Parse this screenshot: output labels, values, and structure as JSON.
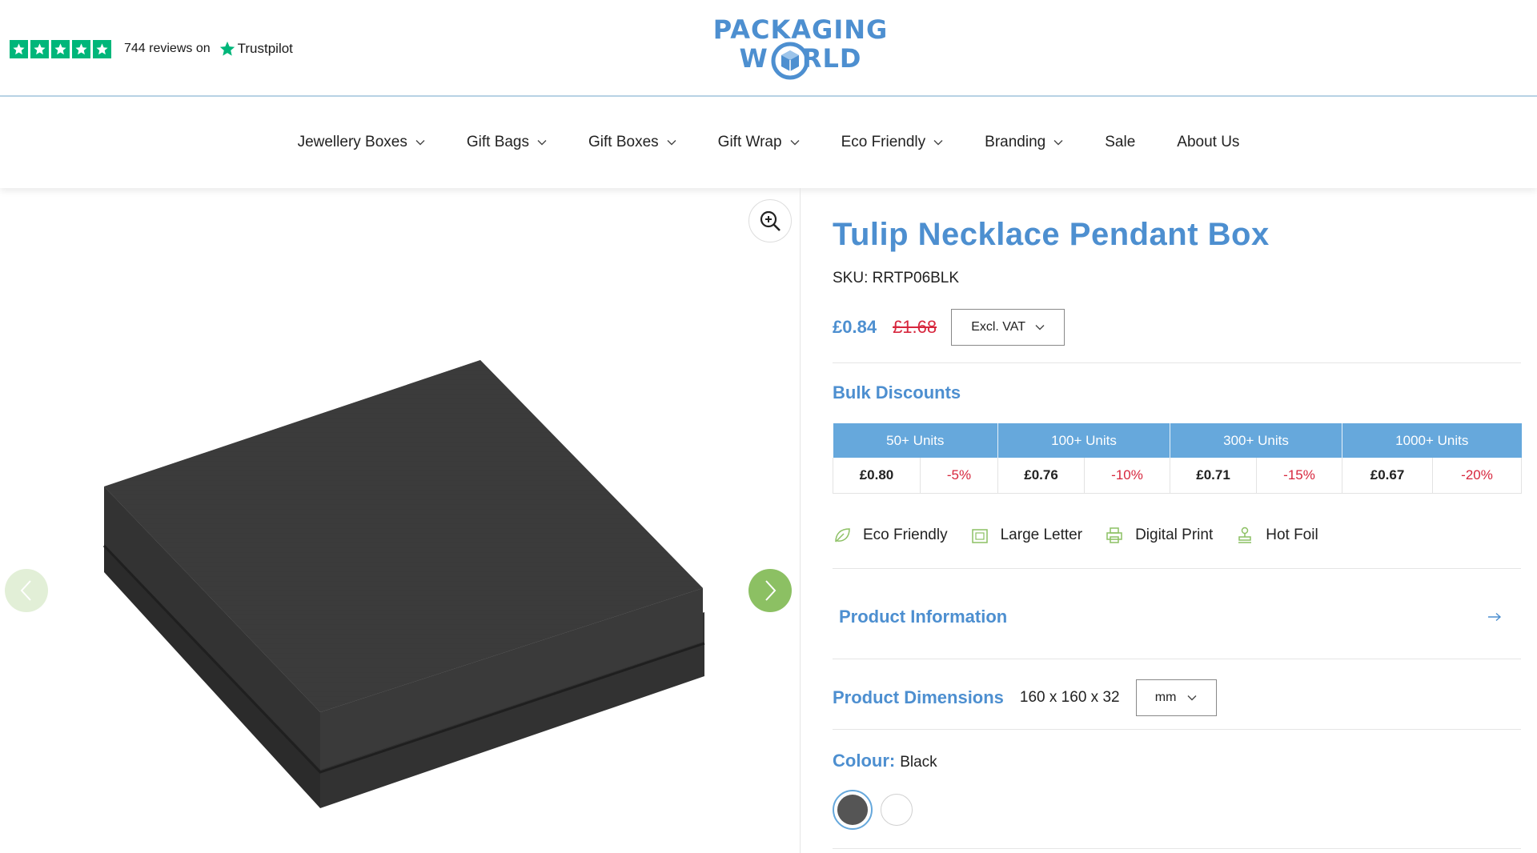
{
  "header": {
    "trustpilot": {
      "reviews_text": "744 reviews on",
      "brand": "Trustpilot",
      "rating_stars": 5,
      "star_color": "#00b67a"
    },
    "logo": {
      "line1": "PACKAGING",
      "line2_left": "W",
      "line2_right": "RLD"
    }
  },
  "nav": {
    "items": [
      {
        "label": "Jewellery Boxes",
        "has_dropdown": true
      },
      {
        "label": "Gift Bags",
        "has_dropdown": true
      },
      {
        "label": "Gift Boxes",
        "has_dropdown": true
      },
      {
        "label": "Gift Wrap",
        "has_dropdown": true
      },
      {
        "label": "Eco Friendly",
        "has_dropdown": true
      },
      {
        "label": "Branding",
        "has_dropdown": true
      },
      {
        "label": "Sale",
        "has_dropdown": false
      },
      {
        "label": "About Us",
        "has_dropdown": false
      }
    ]
  },
  "gallery": {
    "zoom_icon": "zoom-in-icon",
    "prev_icon": "chevron-left-icon",
    "next_icon": "chevron-right-icon"
  },
  "product": {
    "title": "Tulip Necklace Pendant Box",
    "sku": "SKU: RRTP06BLK",
    "price": "£0.84",
    "price_old": "£1.68",
    "vat_option": "Excl. VAT",
    "bulk_title": "Bulk Discounts",
    "bulk": [
      {
        "header": "50+ Units",
        "price": "£0.80",
        "discount": "-5%"
      },
      {
        "header": "100+ Units",
        "price": "£0.76",
        "discount": "-10%"
      },
      {
        "header": "300+ Units",
        "price": "£0.71",
        "discount": "-15%"
      },
      {
        "header": "1000+ Units",
        "price": "£0.67",
        "discount": "-20%"
      }
    ],
    "features": [
      {
        "label": "Eco Friendly",
        "icon": "leaf-icon"
      },
      {
        "label": "Large Letter",
        "icon": "letterbox-icon"
      },
      {
        "label": "Digital Print",
        "icon": "printer-icon"
      },
      {
        "label": "Hot Foil",
        "icon": "stamp-icon"
      }
    ],
    "info_title": "Product Information",
    "dims_title": "Product Dimensions",
    "dims_value": "160 x 160 x 32",
    "unit_option": "mm",
    "colour_title": "Colour:",
    "colour_value": "Black",
    "swatches": [
      {
        "color": "#555555",
        "selected": true
      },
      {
        "color": "#ffffff",
        "selected": false
      }
    ]
  },
  "colors": {
    "brand_blue": "#4d8fd0",
    "table_header": "#66a8dc",
    "sale_red": "#d7263d",
    "arrow_green": "#8cc063"
  }
}
